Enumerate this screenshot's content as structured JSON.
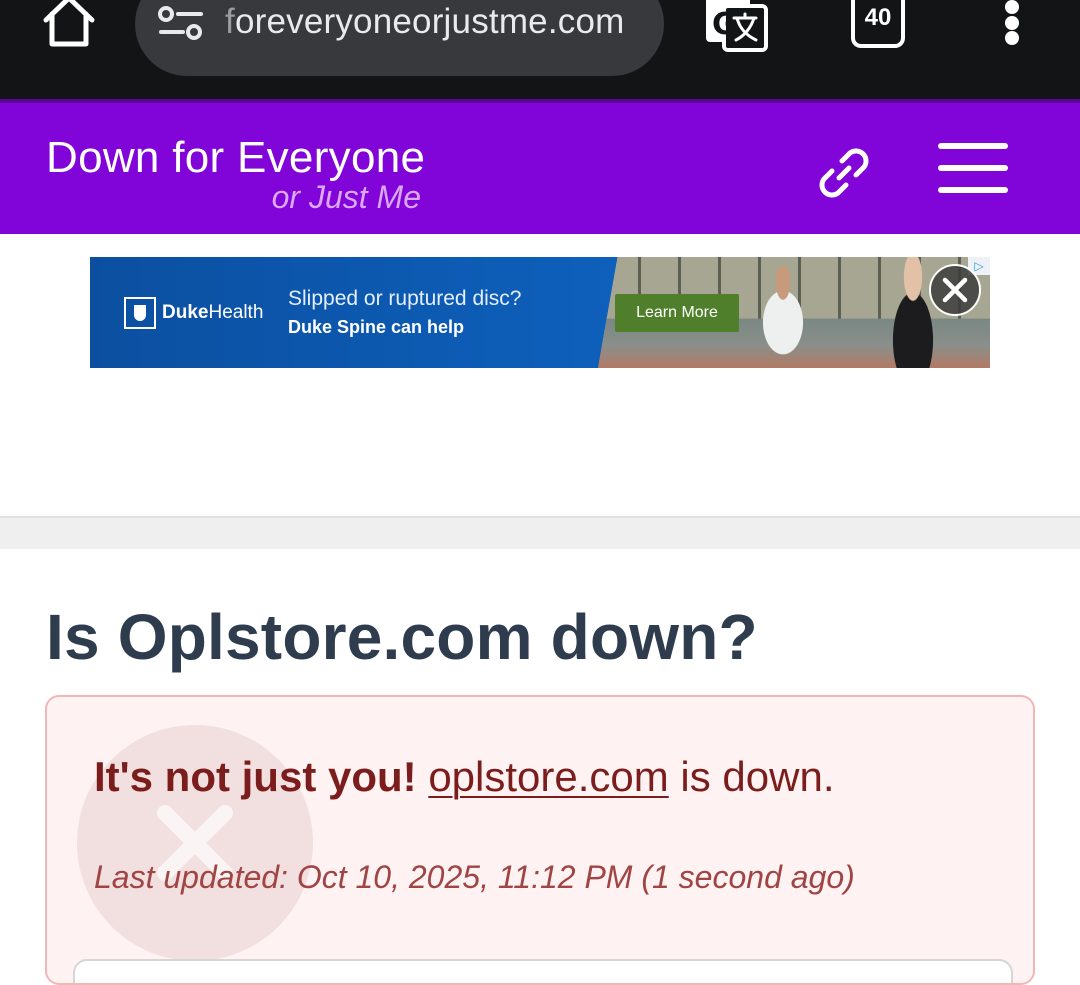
{
  "browser": {
    "url_faded": "f",
    "url": "oreveryoneorjustme.com",
    "tab_count": "40"
  },
  "site": {
    "logo_main": "Down for Everyone",
    "logo_sub": "or Just Me"
  },
  "ad": {
    "brand_bold": "Duke",
    "brand_rest": "Health",
    "headline": "Slipped or ruptured disc?",
    "subline": "Duke Spine can help",
    "cta": "Learn More",
    "choices_glyph": "▷"
  },
  "main": {
    "title": "Is Oplstore.com down?",
    "status_prefix": "It's not just you!",
    "status_link": "oplstore.com",
    "status_suffix": " is down.",
    "last_updated": "Last updated: Oct 10, 2025, 11:12 PM (1 second ago)"
  },
  "colors": {
    "header_bg": "#8104d8",
    "status_bg": "#fef2f2",
    "status_text": "#7c1d1d"
  },
  "icons": [
    "home-icon",
    "site-info-icon",
    "translate-icon",
    "tabs-icon",
    "more-vert-icon",
    "link-icon",
    "menu-icon",
    "close-icon",
    "ad-choices-icon",
    "x-icon"
  ]
}
